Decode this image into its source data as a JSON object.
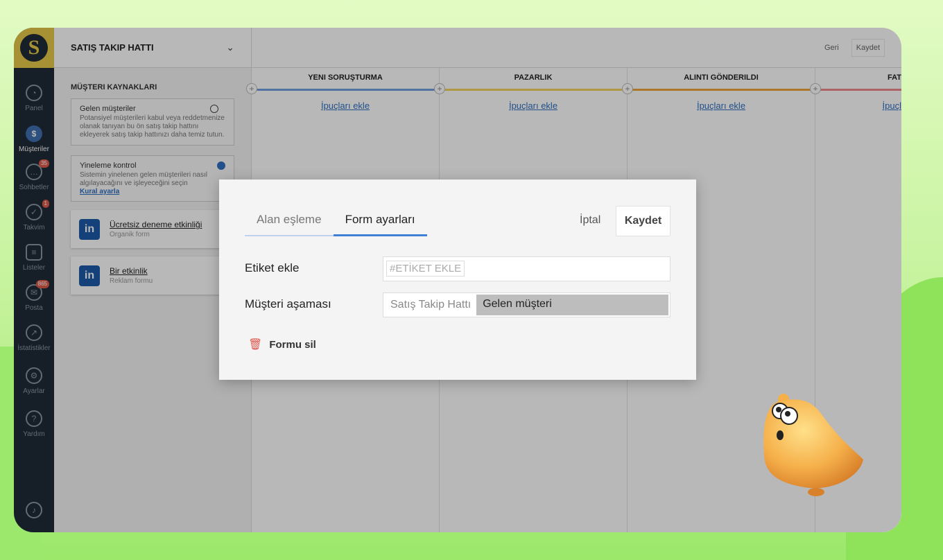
{
  "sidebar": {
    "logo": "S",
    "items": [
      {
        "label": "Panel",
        "icon": "gauge-icon",
        "badge": ""
      },
      {
        "label": "Müşteriler",
        "icon": "dollar-icon",
        "badge": ""
      },
      {
        "label": "Sohbetler",
        "icon": "chat-icon",
        "badge": "35"
      },
      {
        "label": "Takvim",
        "icon": "check-icon",
        "badge": "1"
      },
      {
        "label": "Listeler",
        "icon": "list-icon",
        "badge": ""
      },
      {
        "label": "Posta",
        "icon": "mail-icon",
        "badge": "865"
      },
      {
        "label": "İstatistikler",
        "icon": "chart-icon",
        "badge": ""
      },
      {
        "label": "Ayarlar",
        "icon": "wrench-icon",
        "badge": ""
      },
      {
        "label": "Yardım",
        "icon": "help-icon",
        "badge": ""
      }
    ]
  },
  "leftpanel": {
    "title": "SATIŞ TAKIP HATTI",
    "section": "MÜŞTERI KAYNAKLARI",
    "incoming": {
      "title": "Gelen müşteriler",
      "desc": "Potansiyel müşterileri kabul veya reddetmenize olanak tanıyan bu ön satış takip hattını ekleyerek satış takip hattınızı daha temiz tutun."
    },
    "duplicate": {
      "title": "Yineleme kontrol",
      "desc": "Sistemin yinelenen gelen müşterileri nasıl algılayacağını ve işleyeceğini seçin",
      "link": "Kural ayarla"
    },
    "forms": [
      {
        "name": "Ücretsiz deneme etkinliği",
        "type": "Organik form"
      },
      {
        "name": "Bir etkinlik",
        "type": "Reklam formu"
      }
    ]
  },
  "board": {
    "back": "Geri",
    "save": "Kaydet",
    "columns": [
      {
        "title": "YENI SORUŞTURMA",
        "add": "İpuçları ekle",
        "color": "#6f9fe0"
      },
      {
        "title": "PAZARLIK",
        "add": "İpuçları ekle",
        "color": "#f2d35b"
      },
      {
        "title": "ALINTI GÖNDERILDI",
        "add": "İpuçları ekle",
        "color": "#f0a63a"
      },
      {
        "title": "FAT",
        "add": "İpuçl",
        "color": "#f08a8a"
      }
    ]
  },
  "modal": {
    "tabs": [
      "Alan eşleme",
      "Form ayarları"
    ],
    "cancel": "İptal",
    "save": "Kaydet",
    "tag_label": "Etiket ekle",
    "tag_placeholder": "#ETİKET EKLE",
    "stage_label": "Müşteri aşaması",
    "stage_pipeline": "Satış Takip Hattı",
    "stage_value": "Gelen müşteri",
    "delete": "Formu sil"
  }
}
